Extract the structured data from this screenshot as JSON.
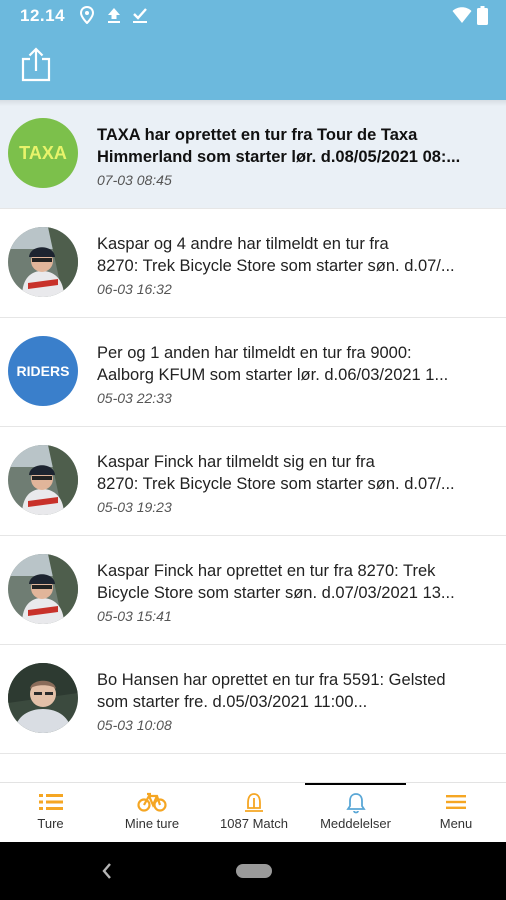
{
  "status_bar": {
    "time": "12.14",
    "icons": [
      "location-icon",
      "upload-icon",
      "download-done-icon",
      "wifi-icon",
      "battery-icon"
    ]
  },
  "app_bar": {
    "background": "#6cb9dd",
    "share_icon": "share-icon"
  },
  "notifications": [
    {
      "avatar_type": "text",
      "avatar_text": "TAXA",
      "avatar_color": "#7cc04b",
      "line1": "TAXA   har oprettet en tur fra Tour de Taxa",
      "line2": "Himmerland som starter lør. d.08/05/2021 08:...",
      "time": "07-03 08:45",
      "unread": true
    },
    {
      "avatar_type": "photo",
      "avatar_photo": "cyclist-photo",
      "line1": "Kaspar og 4 andre har tilmeldt en tur fra",
      "line2": "8270: Trek Bicycle Store som starter søn. d.07/...",
      "time": "06-03 16:32",
      "unread": false
    },
    {
      "avatar_type": "text",
      "avatar_text": "RIDERS",
      "avatar_color": "#3a7fcb",
      "line1": "Per og 1 anden har tilmeldt en tur fra 9000:",
      "line2": "Aalborg KFUM  som starter lør. d.06/03/2021 1...",
      "time": "05-03 22:33",
      "unread": false
    },
    {
      "avatar_type": "photo",
      "avatar_photo": "cyclist-photo",
      "line1": "Kaspar Finck har tilmeldt sig en tur fra",
      "line2": "8270: Trek Bicycle Store som starter søn. d.07/...",
      "time": "05-03 19:23",
      "unread": false
    },
    {
      "avatar_type": "photo",
      "avatar_photo": "cyclist-photo",
      "line1": "Kaspar Finck har oprettet en tur fra 8270: Trek",
      "line2": "Bicycle Store som starter søn. d.07/03/2021 13...",
      "time": "05-03 15:41",
      "unread": false
    },
    {
      "avatar_type": "photo",
      "avatar_photo": "person-photo",
      "line1": "Bo Hansen har oprettet en tur fra 5591: Gelsted",
      "line2": "som starter fre. d.05/03/2021 11:00...",
      "time": "05-03 10:08",
      "unread": false
    }
  ],
  "bottom_nav": {
    "accent": "#f5a623",
    "active_index": 3,
    "tabs": [
      {
        "label": "Ture",
        "icon": "list-icon"
      },
      {
        "label": "Mine ture",
        "icon": "bicycle-icon"
      },
      {
        "label": "1087 Match",
        "icon": "match-icon"
      },
      {
        "label": "Meddelelser",
        "icon": "bell-icon"
      },
      {
        "label": "Menu",
        "icon": "menu-icon"
      }
    ]
  },
  "system_nav": {
    "back_icon": "back-chevron-icon",
    "home_icon": "home-pill-icon"
  }
}
